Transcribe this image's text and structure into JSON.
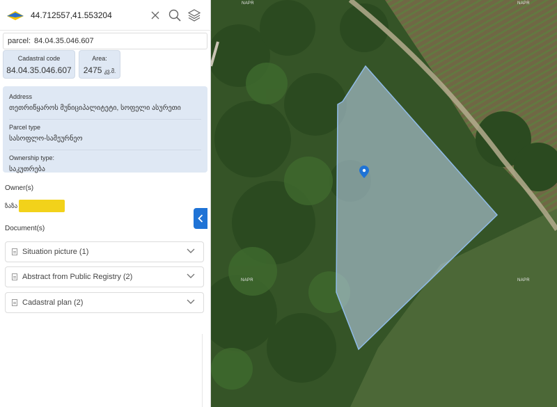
{
  "search": {
    "value": "44.712557,41.553204"
  },
  "parcel_field": {
    "label": "parcel:",
    "value": "84.04.35.046.607"
  },
  "cadastral_card": {
    "label": "Cadastral code",
    "value": "84.04.35.046.607"
  },
  "area_card": {
    "label": "Area:",
    "value": "2475",
    "unit": "კვ.მ."
  },
  "info": {
    "address_label": "Address",
    "address_value": "თეთრიწყაროს მუნიციპალიტეტი, სოფელი ასურეთი",
    "parcel_type_label": "Parcel type",
    "parcel_type_value": "სასოფლო-სამეურნეო",
    "ownership_label": "Ownership type:",
    "ownership_value": "საკუთრება"
  },
  "owners": {
    "label": "Owner(s)",
    "name_prefix": "ზაზა"
  },
  "documents": {
    "label": "Document(s)",
    "items": [
      {
        "label": "Situation picture (1)"
      },
      {
        "label": "Abstract from Public Registry (2)"
      },
      {
        "label": "Cadastral plan (2)"
      }
    ]
  },
  "map": {
    "watermark": "NAPR"
  },
  "colors": {
    "accent": "#1f73d6",
    "card_bg": "#dfe8f4",
    "highlight": "#f2d21a",
    "parcel_fill": "#a9c8e8"
  },
  "icons": [
    "napr-logo-icon",
    "clear-icon",
    "search-icon",
    "layers-icon",
    "file-icon",
    "chevron-down-icon",
    "chevron-left-icon",
    "map-pin-icon"
  ]
}
